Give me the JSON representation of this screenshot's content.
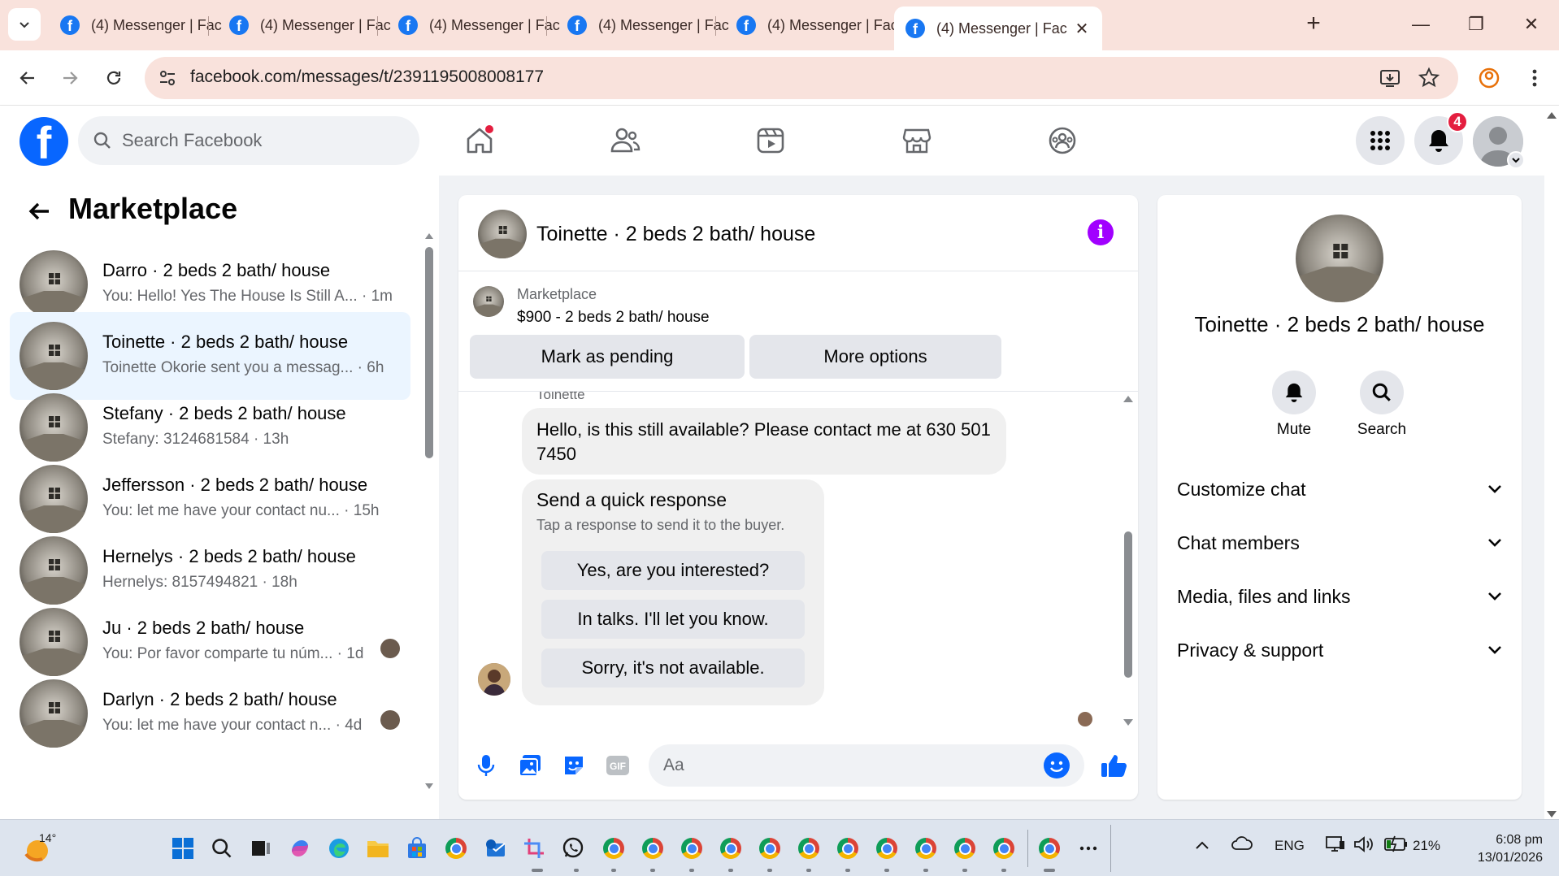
{
  "browser": {
    "tabs": [
      {
        "title": "(4) Messenger | Fac",
        "active": false
      },
      {
        "title": "(4) Messenger | Fac",
        "active": false
      },
      {
        "title": "(4) Messenger | Fac",
        "active": false
      },
      {
        "title": "(4) Messenger | Fac",
        "active": false
      },
      {
        "title": "(4) Messenger | Fac",
        "active": false
      },
      {
        "title": "(4) Messenger | Fac",
        "active": true
      }
    ],
    "url": "facebook.com/messages/t/2391195008008177"
  },
  "fb": {
    "search_placeholder": "Search Facebook",
    "notification_count": "4",
    "brand_color": "#0866ff"
  },
  "sidebar": {
    "title": "Marketplace",
    "conversations": [
      {
        "name": "Darro · 2 beds 2 bath/ house",
        "preview": "You: Hello! Yes The House Is Still A...",
        "time": " · 1m",
        "selected": false
      },
      {
        "name": "Toinette · 2 beds 2 bath/ house",
        "preview": "Toinette Okorie sent you a messag...",
        "time": " · 6h",
        "selected": true
      },
      {
        "name": "Stefany · 2 beds 2 bath/ house",
        "preview": "Stefany: 3124681584",
        "time": " · 13h",
        "selected": false
      },
      {
        "name": "Jeffersson · 2 beds 2 bath/ house",
        "preview": "You: let me have your contact nu...",
        "time": " · 15h",
        "selected": false
      },
      {
        "name": "Hernelys · 2 beds 2 bath/ house",
        "preview": "Hernelys: 8157494821",
        "time": " · 18h",
        "selected": false
      },
      {
        "name": "Ju · 2 beds 2 bath/ house",
        "preview": "You: Por favor comparte tu núm...",
        "time": " · 1d",
        "selected": false
      },
      {
        "name": "Darlyn · 2 beds 2 bath/ house",
        "preview": "You: let me have your contact n...",
        "time": " · 4d",
        "selected": false
      }
    ]
  },
  "chat": {
    "title": "Toinette · 2 beds 2 bath/ house",
    "listing_source": "Marketplace",
    "listing_price": "$900 - 2 beds 2 bath/ house",
    "mark_pending": "Mark as pending",
    "more_options": "More options",
    "sender": "Toinette",
    "message": "Hello, is this still available?  Please contact me at 630 501 7450",
    "quick_title": "Send a quick response",
    "quick_subtitle": "Tap a response to send it to the buyer.",
    "quick_replies": [
      "Yes, are you interested?",
      "In talks. I'll let you know.",
      "Sorry, it's not available."
    ],
    "composer_placeholder": "Aa"
  },
  "info_panel": {
    "name": "Toinette · 2 beds 2 bath/ house",
    "mute": "Mute",
    "search": "Search",
    "sections": [
      "Customize chat",
      "Chat members",
      "Media, files and links",
      "Privacy & support"
    ]
  },
  "taskbar": {
    "temperature": "14°",
    "language": "ENG",
    "battery": "21%",
    "time": "6:08 pm",
    "date": "13/01/2026"
  }
}
